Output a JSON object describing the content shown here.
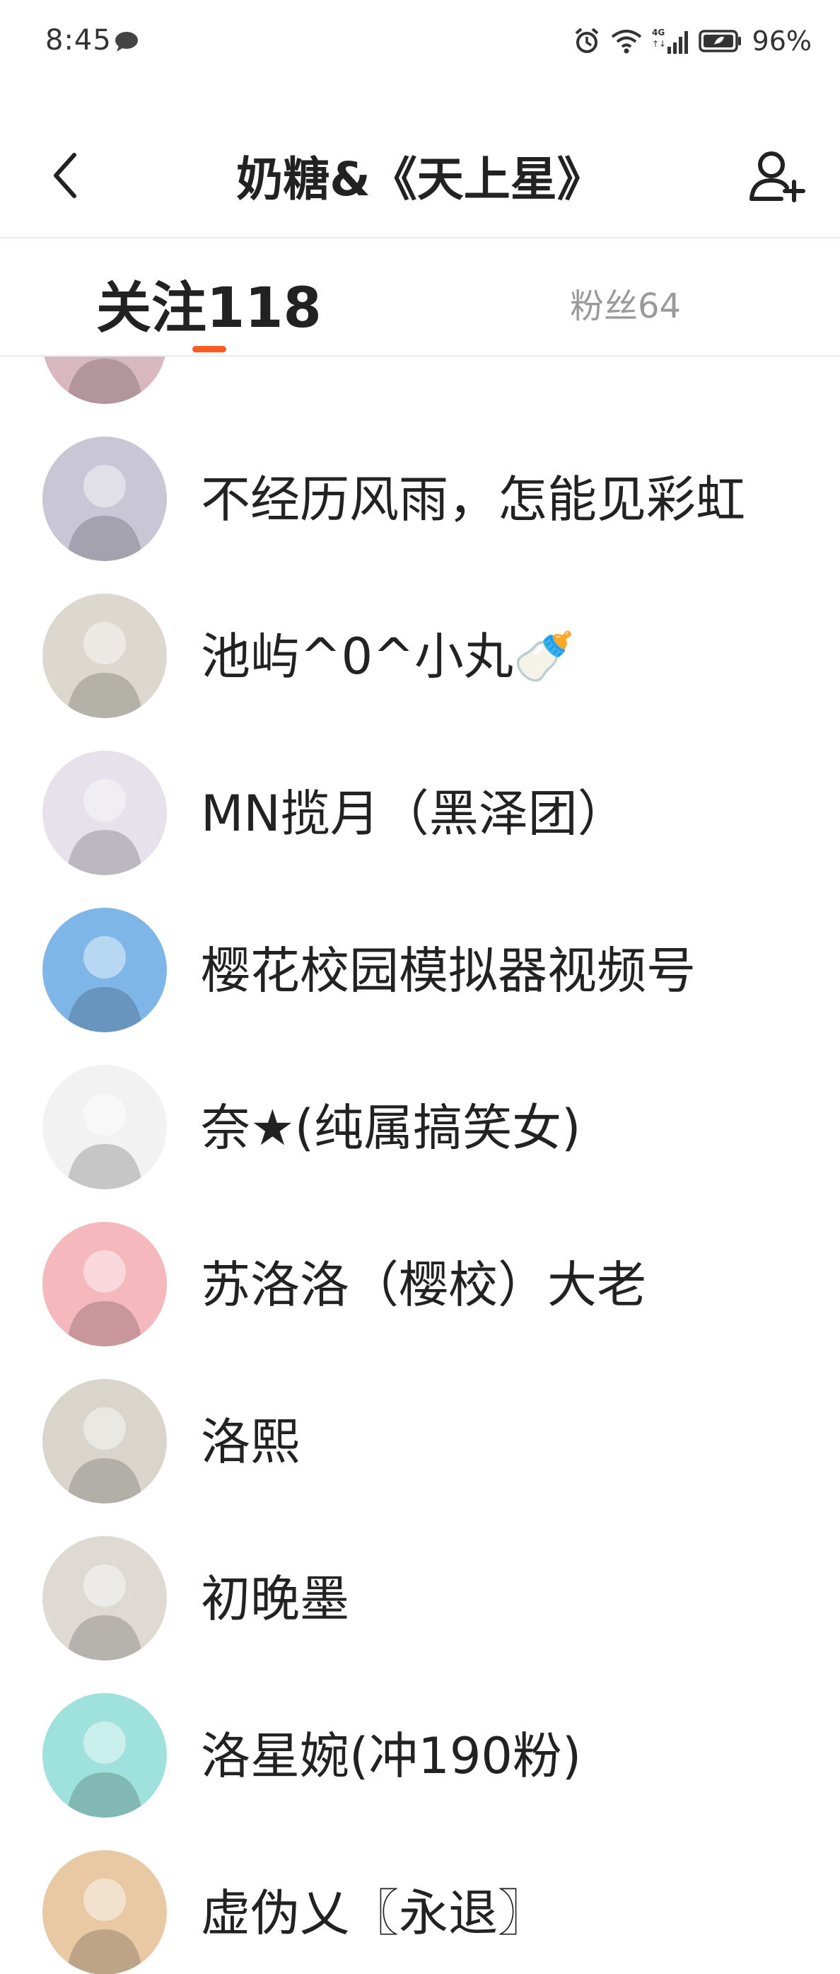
{
  "status_bar": {
    "time": "8:45",
    "battery": "96%",
    "icons": [
      "chat-bubble-icon",
      "alarm-icon",
      "wifi-icon",
      "cellular-4g-icon",
      "battery-icon"
    ]
  },
  "header": {
    "title": "奶糖&《天上星》",
    "back_icon": "chevron-left-icon",
    "add_user_icon": "add-user-icon"
  },
  "tabs": {
    "following_label": "关注118",
    "fans_label": "粉丝64",
    "indicator_color": "#ff5a1f"
  },
  "users": [
    {
      "name": "",
      "avatar_color": "#d9b7c0"
    },
    {
      "name": "不经历风雨，怎能见彩虹",
      "avatar_color": "#c9c6d6"
    },
    {
      "name": "池屿^0^小丸🍼",
      "avatar_color": "#dcd8cf"
    },
    {
      "name": "MN揽月（黑泽团）",
      "avatar_color": "#e6e1ea"
    },
    {
      "name": "樱花校园模拟器视频号",
      "avatar_color": "#7fb6e8"
    },
    {
      "name": "奈★(纯属搞笑女)",
      "avatar_color": "#f2f2f2"
    },
    {
      "name": "苏洛洛（樱校）大老",
      "avatar_color": "#f5b8bd"
    },
    {
      "name": "洛熙",
      "avatar_color": "#d9d5cd"
    },
    {
      "name": "初晚墨",
      "avatar_color": "#dedad3"
    },
    {
      "name": "洛星婉(冲190粉)",
      "avatar_color": "#9fe1dc"
    },
    {
      "name": "虚伪乂〖永退〗",
      "avatar_color": "#e8c9a4"
    }
  ]
}
